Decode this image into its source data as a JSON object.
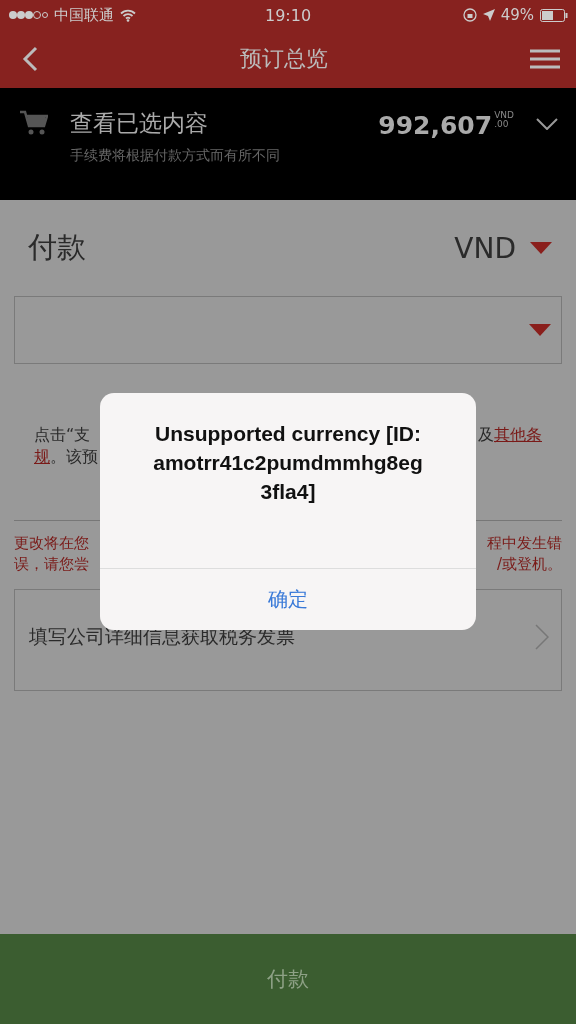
{
  "status_bar": {
    "carrier": "中国联通",
    "time": "19:10",
    "battery": "49%"
  },
  "nav": {
    "title": "预订总览"
  },
  "summary": {
    "title": "查看已选内容",
    "subtitle": "手续费将根据付款方式而有所不同",
    "amount": "992,607",
    "currency": "VND",
    "cents": ".00"
  },
  "payment": {
    "heading": "付款",
    "currency": "VND"
  },
  "terms": {
    "line_1_left": "点击“支",
    "line_1_right_text": "及",
    "line_1_right_link": "其他条",
    "line_2_link": "规",
    "line_2_text": "。该预"
  },
  "notice": {
    "line_1_left": "更改将在您",
    "line_1_right": "程中发生错",
    "line_2_left": "误，请您尝",
    "line_2_right": "/或登机。"
  },
  "invoice_row": {
    "label": "填写公司详细信息获取税务发票"
  },
  "footer_button": {
    "label": "付款"
  },
  "dialog": {
    "message": "Unsupported currency [ID: amotrr41c2pumdmmhg8eg3fla4]",
    "button": "确定"
  }
}
